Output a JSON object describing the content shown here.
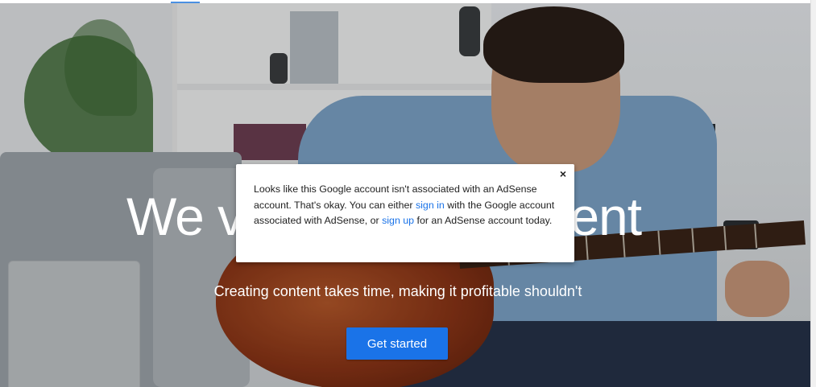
{
  "hero": {
    "headline_left": "We v",
    "headline_right": "tent",
    "subheadline": "Creating content takes time, making it profitable shouldn't",
    "cta_label": "Get started"
  },
  "dialog": {
    "close_glyph": "×",
    "text_1": "Looks like this Google account isn't associated with an AdSense account. That's okay. You can either ",
    "sign_in_link": "sign in",
    "text_2": " with the Google account associated with AdSense, or ",
    "sign_up_link": "sign up",
    "text_3": " for an AdSense account today."
  },
  "colors": {
    "accent": "#1a73e8",
    "link": "#1a73e8"
  }
}
